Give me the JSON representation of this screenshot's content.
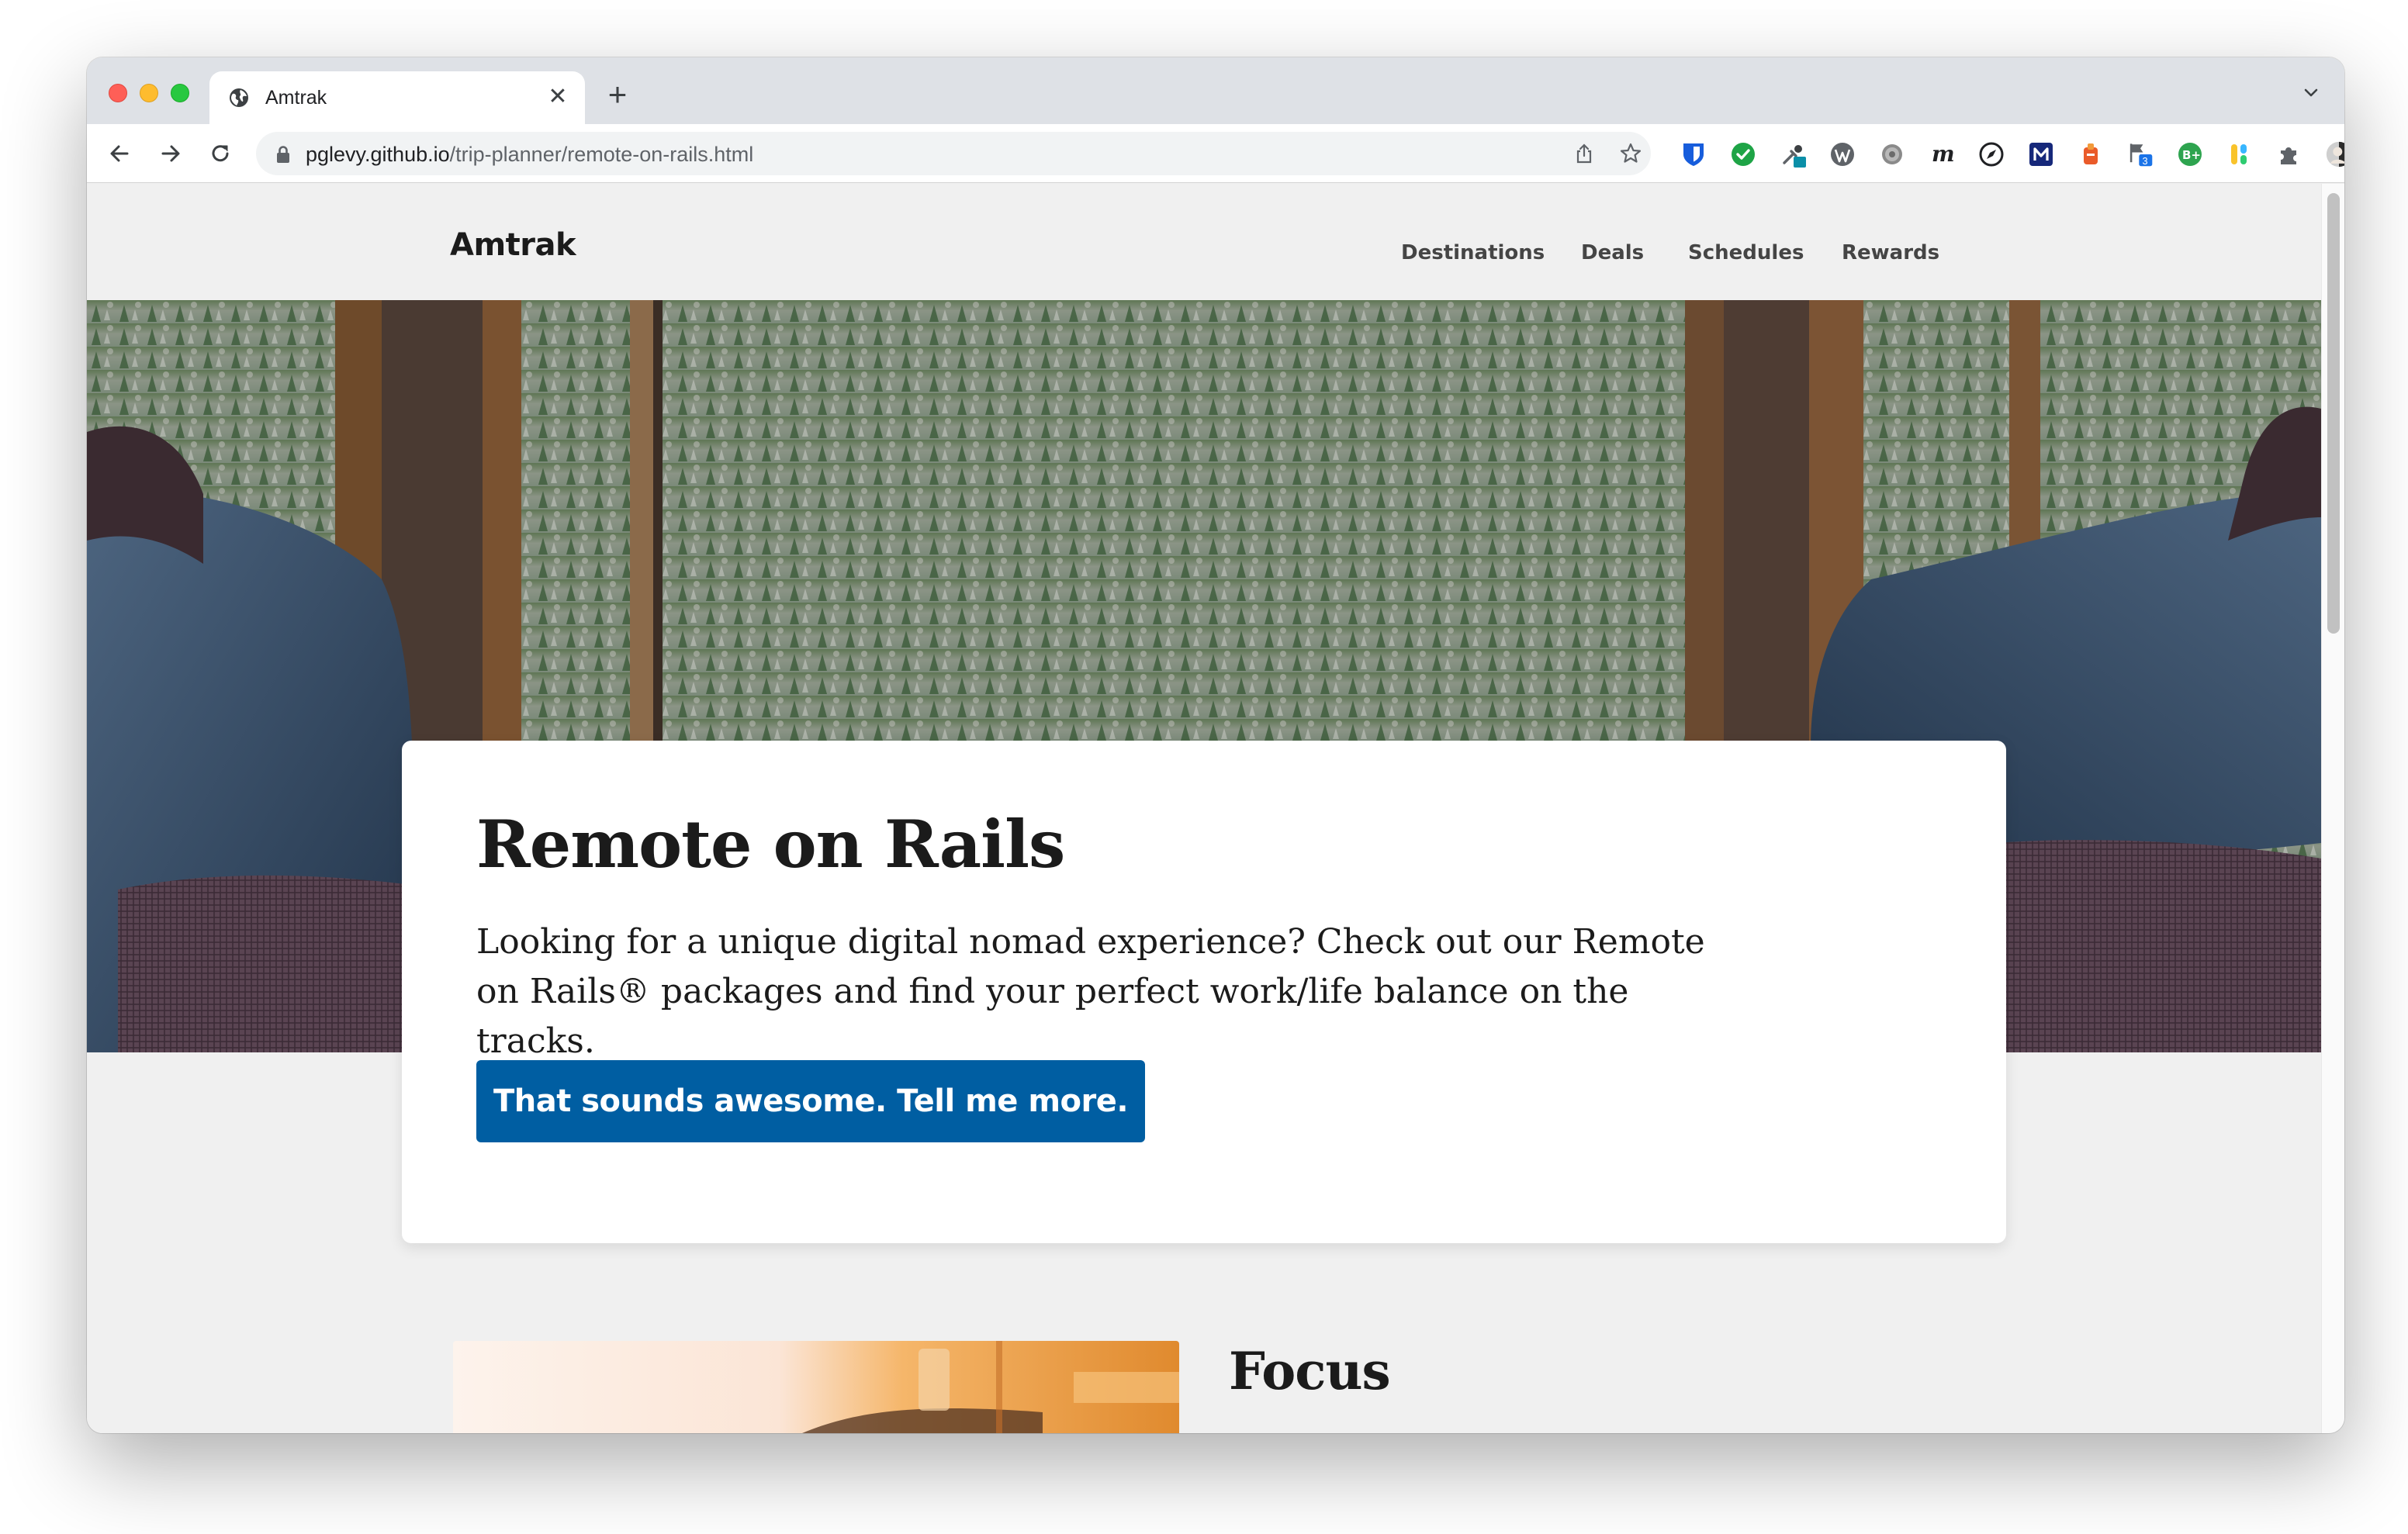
{
  "browser": {
    "tab_title": "Amtrak",
    "new_tab_label": "+",
    "close_tab_label": "✕",
    "url_host": "pglevy.github.io",
    "url_path": "/trip-planner/remote-on-rails.html",
    "extensions_badge_count": "3",
    "icons": [
      "globe-icon",
      "back-icon",
      "forward-icon",
      "reload-icon",
      "lock-icon",
      "share-icon",
      "bookmark-star-icon",
      "bitwarden-icon",
      "check-extension-icon",
      "dropper-icon",
      "wordpress-icon",
      "gear-extension-icon",
      "m-extension-icon",
      "compass-icon",
      "m-square-icon",
      "bell-extension-icon",
      "flag-extension-icon",
      "b-plus-icon",
      "colorful-extension-icon",
      "puzzle-icon",
      "profile-avatar",
      "kebab-menu-icon",
      "tab-menu-chevron-icon"
    ]
  },
  "site": {
    "brand": "Amtrak",
    "nav": [
      "Destinations",
      "Deals",
      "Schedules",
      "Rewards"
    ]
  },
  "hero": {
    "title": "Remote on Rails",
    "body": "Looking for a unique digital nomad experience? Check out our Remote on Rails® packages and find your perfect work/life balance on the tracks.",
    "cta_label": "That sounds awesome. Tell me more."
  },
  "feature": {
    "title": "Focus"
  },
  "colors": {
    "cta_background": "#005ea2",
    "page_background": "#f0f0f0",
    "text": "#1b1b1b"
  }
}
